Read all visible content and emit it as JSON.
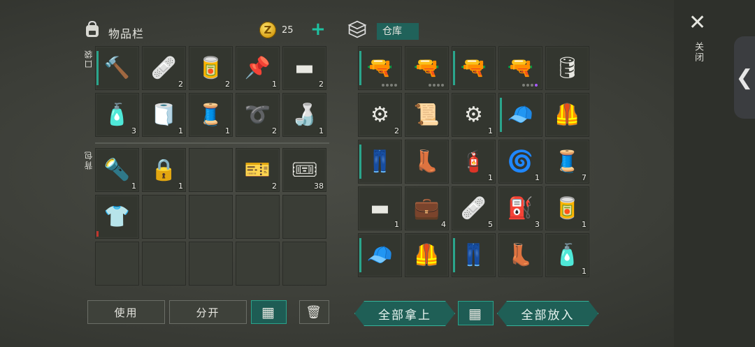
{
  "inventory": {
    "title": "物品栏",
    "coins": "25",
    "coin_symbol": "Z",
    "plus_label": "+",
    "pocket_label": "口袋",
    "backpack_label": "背包",
    "pocket_items": [
      {
        "name": "hammer",
        "icon": "🔨",
        "count": ""
      },
      {
        "name": "bandage",
        "icon": "🩹",
        "count": "2"
      },
      {
        "name": "soda-can",
        "icon": "🥫",
        "count": "2"
      },
      {
        "name": "nails",
        "icon": "📌",
        "count": "1"
      },
      {
        "name": "iron-ingot",
        "icon": "▬",
        "count": "2"
      },
      {
        "name": "medicine-bottle",
        "icon": "🧴",
        "count": "3"
      },
      {
        "name": "cloth",
        "icon": "🧻",
        "count": "1"
      },
      {
        "name": "wire-spool",
        "icon": "🧵",
        "count": "1"
      },
      {
        "name": "electrical-wire",
        "icon": "➰",
        "count": "2"
      },
      {
        "name": "plastic-bottle",
        "icon": "🍶",
        "count": "1"
      }
    ],
    "backpack_items": [
      {
        "name": "flashlight",
        "icon": "🔦",
        "count": "1"
      },
      {
        "name": "padlock-key",
        "icon": "🔒",
        "count": "1"
      },
      {
        "name": "empty",
        "icon": "",
        "count": ""
      },
      {
        "name": "coupon-orange",
        "icon": "🎫",
        "count": "2"
      },
      {
        "name": "coupon-green",
        "icon": "🎟",
        "count": "38"
      },
      {
        "name": "shirt",
        "icon": "👕",
        "count": ""
      },
      {
        "name": "empty",
        "icon": "",
        "count": ""
      },
      {
        "name": "empty",
        "icon": "",
        "count": ""
      },
      {
        "name": "empty",
        "icon": "",
        "count": ""
      },
      {
        "name": "empty",
        "icon": "",
        "count": ""
      },
      {
        "name": "empty",
        "icon": "",
        "count": ""
      },
      {
        "name": "empty",
        "icon": "",
        "count": ""
      },
      {
        "name": "empty",
        "icon": "",
        "count": ""
      },
      {
        "name": "empty",
        "icon": "",
        "count": ""
      },
      {
        "name": "empty",
        "icon": "",
        "count": ""
      }
    ],
    "buttons": {
      "use": "使用",
      "split": "分开",
      "sort_icon": "▦",
      "trash_icon": "🗑"
    }
  },
  "storage": {
    "title": "仓库",
    "items": [
      {
        "name": "pistol",
        "icon": "🔫",
        "count": ""
      },
      {
        "name": "assault-rifle",
        "icon": "🔫",
        "count": ""
      },
      {
        "name": "grenade-launcher",
        "icon": "🔫",
        "count": ""
      },
      {
        "name": "rifle",
        "icon": "🔫",
        "count": ""
      },
      {
        "name": "blue-fuel-tank",
        "icon": "🛢",
        "count": ""
      },
      {
        "name": "engine-part",
        "icon": "⚙",
        "count": "2"
      },
      {
        "name": "blueprint-scroll",
        "icon": "📜",
        "count": ""
      },
      {
        "name": "gear",
        "icon": "⚙",
        "count": "1"
      },
      {
        "name": "camo-cap",
        "icon": "🧢",
        "count": ""
      },
      {
        "name": "camo-vest",
        "icon": "🦺",
        "count": ""
      },
      {
        "name": "camo-pants",
        "icon": "👖",
        "count": ""
      },
      {
        "name": "boots",
        "icon": "👢",
        "count": ""
      },
      {
        "name": "gas-cylinder",
        "icon": "🧯",
        "count": "1"
      },
      {
        "name": "spring",
        "icon": "🌀",
        "count": "1"
      },
      {
        "name": "wire-spool",
        "icon": "🧵",
        "count": "7"
      },
      {
        "name": "iron-ingot",
        "icon": "▬",
        "count": "1"
      },
      {
        "name": "medkit",
        "icon": "💼",
        "count": "4"
      },
      {
        "name": "bandage",
        "icon": "🩹",
        "count": "5"
      },
      {
        "name": "jerrycan",
        "icon": "⛽",
        "count": "3"
      },
      {
        "name": "oil-filter",
        "icon": "🥫",
        "count": "1"
      },
      {
        "name": "camo-cap",
        "icon": "🧢",
        "count": ""
      },
      {
        "name": "camo-vest",
        "icon": "🦺",
        "count": ""
      },
      {
        "name": "camo-pants",
        "icon": "👖",
        "count": ""
      },
      {
        "name": "boots",
        "icon": "👢",
        "count": ""
      },
      {
        "name": "spray-paint",
        "icon": "🧴",
        "count": "1"
      }
    ],
    "buttons": {
      "take_all": "全部拿上",
      "sort_icon": "▦",
      "put_all": "全部放入"
    }
  },
  "close_label": "关闭",
  "close_icon": "✕",
  "side_handle_icon": "❮"
}
